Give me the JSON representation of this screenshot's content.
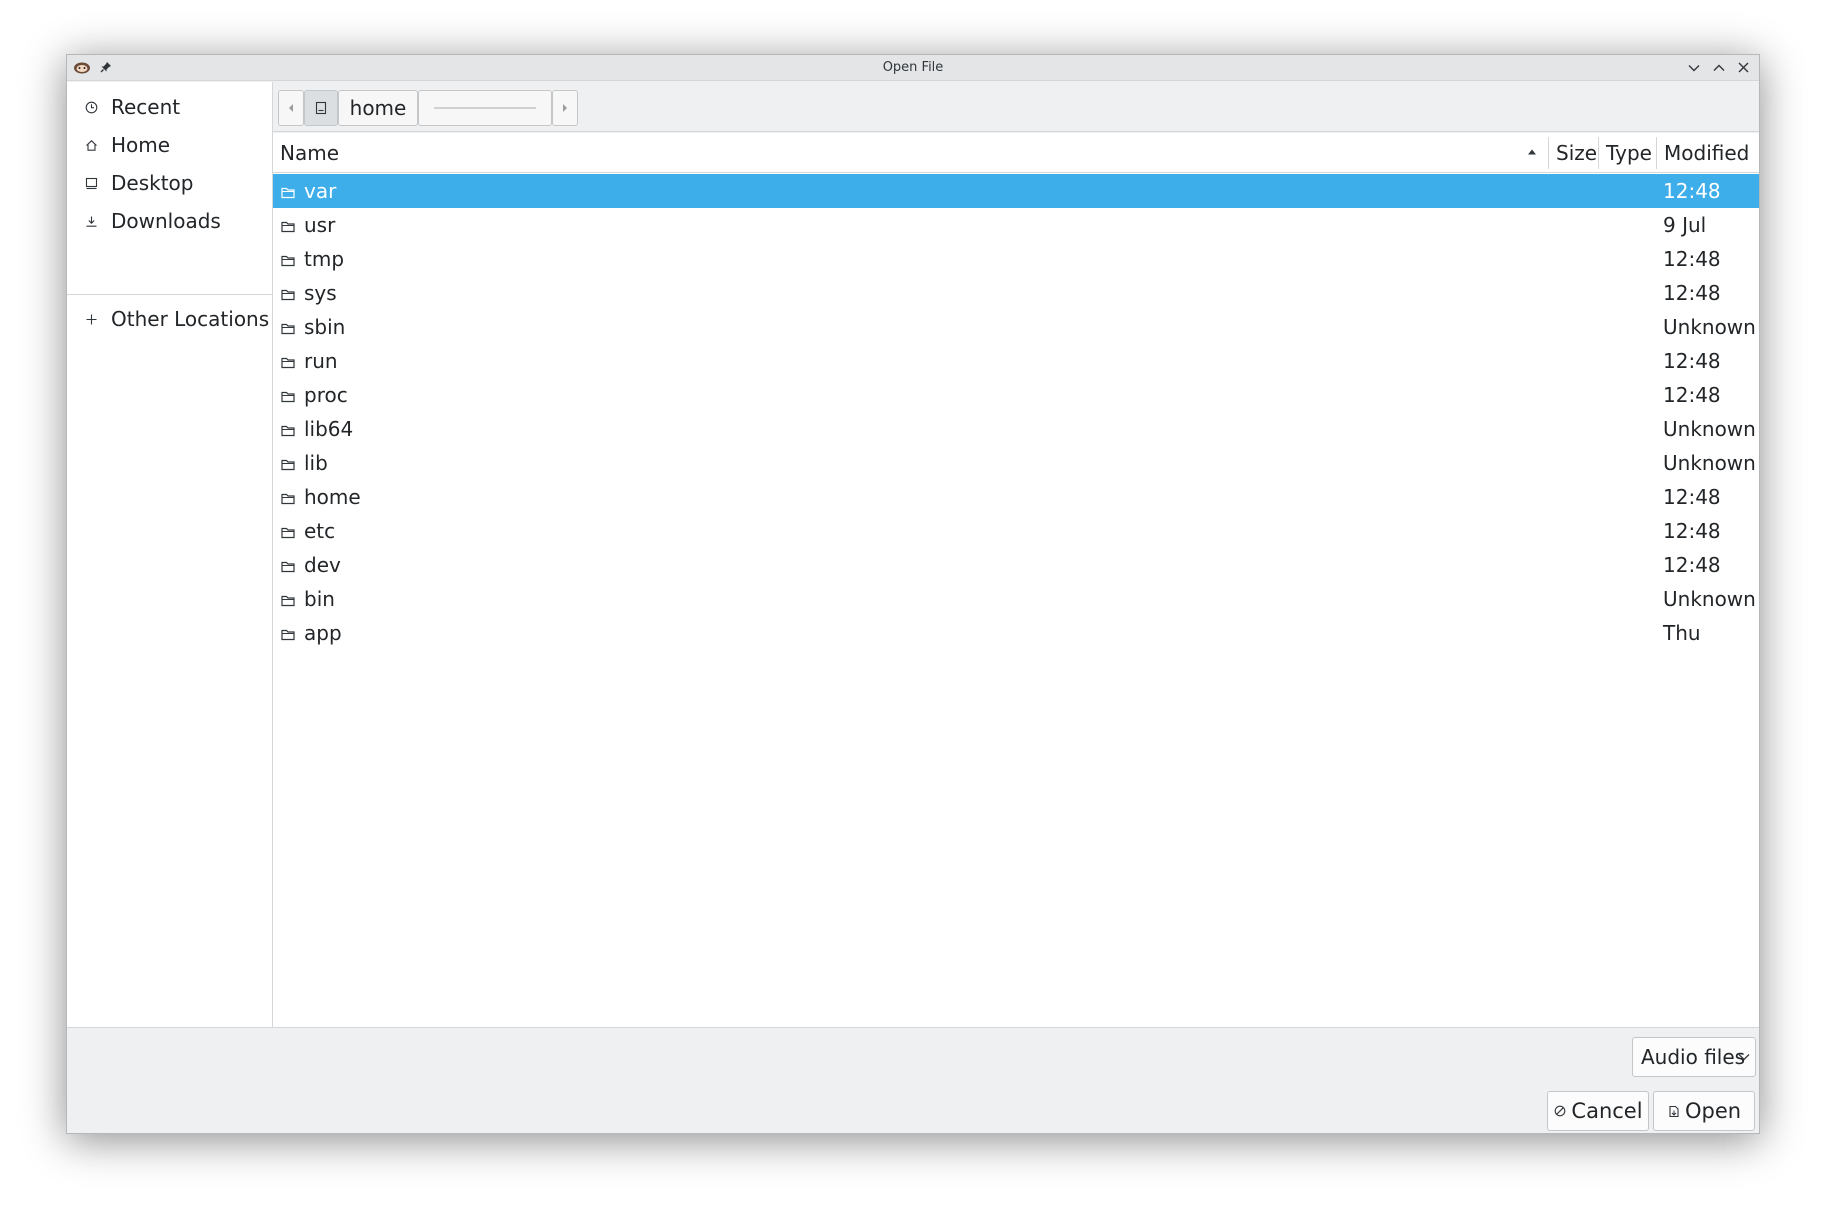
{
  "window": {
    "title": "Open File"
  },
  "sidebar": {
    "places": [
      {
        "label": "Recent",
        "icon": "clock-icon"
      },
      {
        "label": "Home",
        "icon": "home-icon"
      },
      {
        "label": "Desktop",
        "icon": "desktop-icon"
      },
      {
        "label": "Downloads",
        "icon": "download-icon"
      }
    ],
    "other": {
      "label": "Other Locations",
      "icon": "plus-icon"
    }
  },
  "pathbar": {
    "segment": "home"
  },
  "columns": {
    "name": "Name",
    "size": "Size",
    "type": "Type",
    "modified": "Modified"
  },
  "files": [
    {
      "name": "var",
      "modified": "12:48",
      "selected": true
    },
    {
      "name": "usr",
      "modified": "9 Jul"
    },
    {
      "name": "tmp",
      "modified": "12:48"
    },
    {
      "name": "sys",
      "modified": "12:48"
    },
    {
      "name": "sbin",
      "modified": "Unknown"
    },
    {
      "name": "run",
      "modified": "12:48"
    },
    {
      "name": "proc",
      "modified": "12:48"
    },
    {
      "name": "lib64",
      "modified": "Unknown"
    },
    {
      "name": "lib",
      "modified": "Unknown"
    },
    {
      "name": "home",
      "modified": "12:48"
    },
    {
      "name": "etc",
      "modified": "12:48"
    },
    {
      "name": "dev",
      "modified": "12:48"
    },
    {
      "name": "bin",
      "modified": "Unknown"
    },
    {
      "name": "app",
      "modified": "Thu"
    }
  ],
  "filter": {
    "selected": "Audio files"
  },
  "buttons": {
    "cancel": "Cancel",
    "open": "Open"
  },
  "colors": {
    "selection": "#3daee9",
    "window_bg": "#eff0f1",
    "text": "#232629"
  }
}
